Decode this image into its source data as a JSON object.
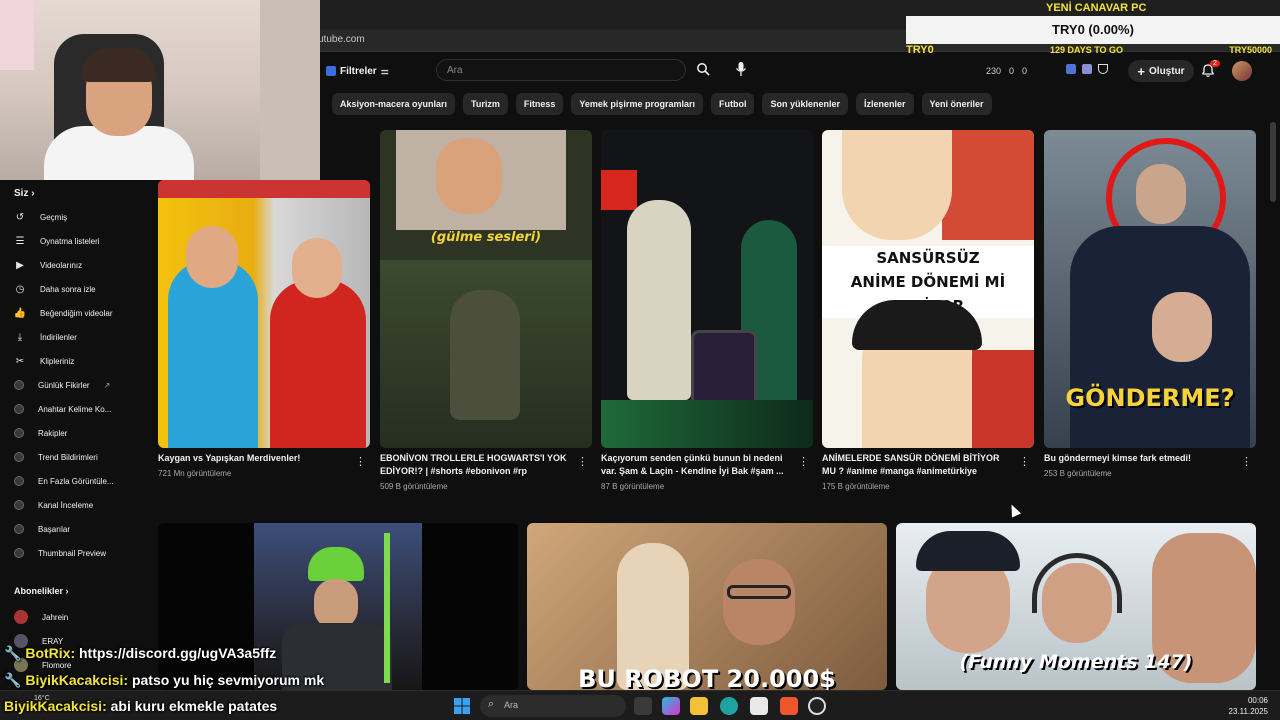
{
  "browser": {
    "url": "utube.com"
  },
  "overlay": {
    "title": "YENİ CANAVAR PC",
    "value": "TRY0 (0.00%)",
    "left_label": "TRY0",
    "days_label": "129 DAYS TO GO",
    "right_label": "TRY50000"
  },
  "topbar": {
    "filters_label": "Filtreler",
    "search_placeholder": "Ara",
    "stats": [
      "230",
      "0",
      "0"
    ],
    "create_label": "Oluştur",
    "notification_count": "2"
  },
  "chips": [
    "Aksiyon-macera oyunları",
    "Turizm",
    "Fitness",
    "Yemek pişirme programları",
    "Futbol",
    "Son yüklenenler",
    "İzlenenler",
    "Yeni öneriler"
  ],
  "sidebar": {
    "you_label": "Siz",
    "items": [
      {
        "label": "Geçmiş",
        "icon": "history-icon"
      },
      {
        "label": "Oynatma listeleri",
        "icon": "playlist-icon"
      },
      {
        "label": "Videolarınız",
        "icon": "your-videos-icon"
      },
      {
        "label": "Daha sonra izle",
        "icon": "watch-later-icon"
      },
      {
        "label": "Beğendiğim videolar",
        "icon": "like-icon"
      },
      {
        "label": "İndirilenler",
        "icon": "download-icon"
      },
      {
        "label": "Klipleriniz",
        "icon": "clips-icon"
      },
      {
        "label": "Günlük Fikirler",
        "icon": "extension-icon"
      },
      {
        "label": "Anahtar Kelime Ko...",
        "icon": "extension-icon"
      },
      {
        "label": "Rakipler",
        "icon": "extension-icon"
      },
      {
        "label": "Trend Bildirimleri",
        "icon": "extension-icon"
      },
      {
        "label": "En Fazla Görüntüle...",
        "icon": "extension-icon"
      },
      {
        "label": "Kanal İnceleme",
        "icon": "extension-icon"
      },
      {
        "label": "Başarılar",
        "icon": "extension-icon"
      },
      {
        "label": "Thumbnail Preview",
        "icon": "extension-icon"
      }
    ],
    "subscriptions_label": "Abonelikler",
    "subscriptions": [
      "Jahrein",
      "ERAY",
      "Flomore"
    ]
  },
  "videos": [
    {
      "title": "Kaygan vs Yapışkan Merdivenler!",
      "meta": "721 Mn görüntüleme"
    },
    {
      "title": "EBONİVON TROLLERLE HOGWARTS'I YOK EDİYOR!? | #shorts #ebonivon #rp",
      "meta": "509 B görüntüleme"
    },
    {
      "title": "Kaçıyorum senden çünkü bunun bi nedeni var. Şam & Laçin - Kendine İyi Bak #şam ...",
      "meta": "87 B görüntüleme"
    },
    {
      "title": "ANİMELERDE SANSÜR DÖNEMİ BİTİYOR MU ? #anime #manga #animetürkiye",
      "meta": "175 B görüntüleme"
    },
    {
      "title": "Bu göndermeyi kimse fark etmedi!",
      "meta": "253 B görüntüleme"
    }
  ],
  "thumb_texts": {
    "laugh": "(gülme sesleri)",
    "anime": "SANSÜRSÜZ ANİME DÖNEMİ Mİ GELİYOR",
    "reference": "GÖNDERME?",
    "robot": "BU ROBOT 20.000$",
    "funny": "(Funny Moments 147)"
  },
  "chat": [
    {
      "user": "BotRix:",
      "message": "https://discord.gg/ugVA3a5ffz"
    },
    {
      "user": "BiyikKacakcisi:",
      "message": "patso yu hiç sevmiyorum mk"
    },
    {
      "user": "BiyikKacakcisi:",
      "message": "abi kuru ekmekle patates"
    }
  ],
  "taskbar": {
    "search_placeholder": "Ara",
    "weather": "16°C",
    "time": "00:06",
    "date": "23.11.2025"
  }
}
